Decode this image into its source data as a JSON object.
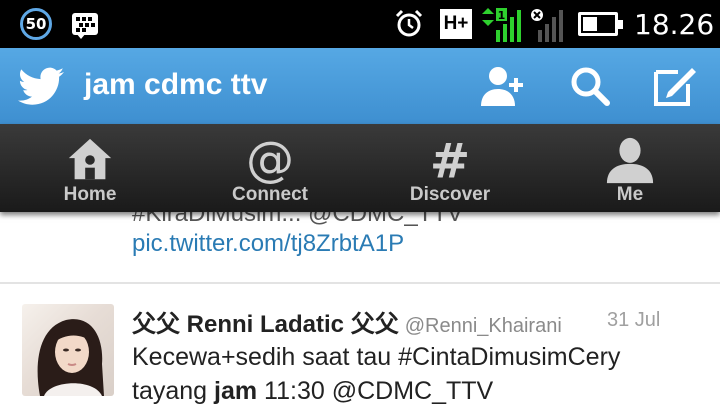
{
  "status_bar": {
    "notification_badge": "50",
    "network_type": "H+",
    "sim1_indicator": "1",
    "battery_level": 0.45,
    "time": "18.26",
    "icons": [
      "bbm-icon",
      "alarm-icon",
      "signal-icon",
      "signal-x-icon",
      "battery-icon"
    ]
  },
  "app_bar": {
    "title": "jam cdmc ttv",
    "accent_color": "#4a9cdc",
    "actions": [
      "add-user-icon",
      "search-icon",
      "compose-icon"
    ]
  },
  "nav": {
    "tabs": [
      {
        "label": "Home",
        "icon": "home-icon"
      },
      {
        "label": "Connect",
        "icon": "at-icon"
      },
      {
        "label": "Discover",
        "icon": "hash-icon"
      },
      {
        "label": "Me",
        "icon": "person-icon"
      }
    ]
  },
  "feed": {
    "partial_tweet": {
      "cut_line": "#KiraDiMusim... @CDMC_TTV",
      "link": "pic.twitter.com/tj8ZrbtA1P"
    },
    "tweet": {
      "name": "父父 Renni Ladatic 父父",
      "handle": "@Renni_Khairani",
      "date": "31 Jul",
      "text_before": "Kecewa+sedih saat tau #CintaDimusimCery tayang ",
      "text_bold": "jam",
      "text_after": " 11:30 @CDMC_TTV"
    }
  }
}
